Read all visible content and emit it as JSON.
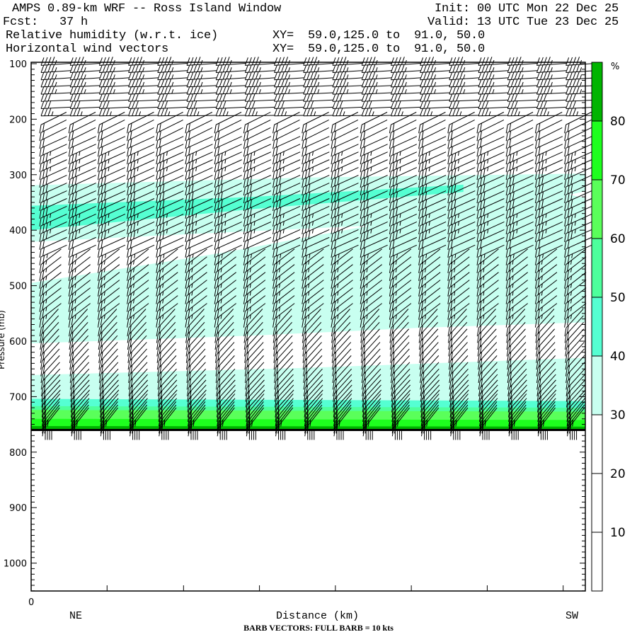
{
  "header": {
    "title": "AMPS 0.89-km WRF -- Ross Island Window",
    "init": "Init: 00 UTC Mon 22 Dec 25",
    "fcst": "Fcst:   37 h",
    "valid": "Valid: 13 UTC Tue 23 Dec 25",
    "field1": "Relative humidity (w.r.t. ice)",
    "field1_xy": "XY=  59.0,125.0 to  91.0, 50.0",
    "field2": "Horizontal wind vectors",
    "field2_xy": "XY=  59.0,125.0 to  91.0, 50.0"
  },
  "chart_data": {
    "type": "heatmap",
    "title": "Relative humidity (w.r.t. ice) and horizontal wind vectors cross-section",
    "xlabel": "Distance (km)",
    "x_start_label": "0",
    "x_left_label": "NE",
    "x_right_label": "SW",
    "ylabel": "Pressure (mb)",
    "ylim": [
      1050,
      100
    ],
    "y_ticks": [
      "100",
      "200",
      "300",
      "400",
      "500",
      "600",
      "700",
      "800",
      "900",
      "1000"
    ],
    "y_tick_values": [
      100,
      200,
      300,
      400,
      500,
      600,
      700,
      800,
      900,
      1000
    ],
    "x_range": [
      0,
      100
    ],
    "x_major_ticks": [
      0,
      13.7,
      27.5,
      41.2,
      54.9,
      68.6,
      82.3,
      96.0
    ],
    "surface_pressure": 760,
    "colorbar": {
      "unit": "%",
      "labels": [
        "80",
        "70",
        "60",
        "50",
        "40",
        "30",
        "20",
        "10"
      ],
      "bins": [
        {
          "min": 80,
          "max": 100,
          "color": "#00b400"
        },
        {
          "min": 70,
          "max": 80,
          "color": "#1eff1e"
        },
        {
          "min": 60,
          "max": 70,
          "color": "#5aff5a"
        },
        {
          "min": 50,
          "max": 60,
          "color": "#4dff9c"
        },
        {
          "min": 40,
          "max": 50,
          "color": "#55ffd2"
        },
        {
          "min": 30,
          "max": 40,
          "color": "#c8fff0"
        },
        {
          "min": 20,
          "max": 30,
          "color": "#ffffff"
        },
        {
          "min": 10,
          "max": 20,
          "color": "#ffffff"
        },
        {
          "min": 0,
          "max": 10,
          "color": "#ffffff"
        }
      ]
    },
    "rh_regions": [
      {
        "bin": "30-40",
        "color": "#c8fff0",
        "points": [
          [
            0,
            319
          ],
          [
            50,
            305
          ],
          [
            100,
            298
          ],
          [
            100,
            566
          ],
          [
            70,
            576
          ],
          [
            40,
            590
          ],
          [
            0,
            604
          ]
        ]
      },
      {
        "bin": "<30",
        "color": "#ffffff",
        "points": [
          [
            0,
            421
          ],
          [
            35,
            404
          ],
          [
            61,
            392
          ],
          [
            35,
            440
          ],
          [
            0,
            495
          ]
        ]
      },
      {
        "bin": "<30",
        "color": "#ffffff",
        "points": [
          [
            100,
            330
          ],
          [
            97,
            336
          ],
          [
            100,
            342
          ]
        ]
      },
      {
        "bin": "30-40",
        "color": "#c8fff0",
        "points": [
          [
            0,
            661
          ],
          [
            50,
            648
          ],
          [
            100,
            630
          ],
          [
            100,
            762
          ],
          [
            0,
            762
          ]
        ]
      },
      {
        "bin": "40-50",
        "color": "#55ffd2",
        "points": [
          [
            0,
            356
          ],
          [
            40,
            340
          ],
          [
            78,
            318
          ],
          [
            78,
            331
          ],
          [
            40,
            362
          ],
          [
            0,
            400
          ]
        ]
      },
      {
        "bin": "40-50",
        "color": "#55ffd2",
        "points": [
          [
            0,
            704
          ],
          [
            100,
            708
          ],
          [
            100,
            762
          ],
          [
            0,
            762
          ]
        ]
      },
      {
        "bin": "50-60",
        "color": "#4dff9c",
        "points": [
          [
            0,
            717
          ],
          [
            100,
            720
          ],
          [
            100,
            762
          ],
          [
            0,
            762
          ]
        ]
      },
      {
        "bin": "60-70",
        "color": "#5aff5a",
        "points": [
          [
            0,
            724
          ],
          [
            100,
            727
          ],
          [
            100,
            762
          ],
          [
            0,
            762
          ]
        ]
      },
      {
        "bin": "70-80",
        "color": "#1eff1e",
        "points": [
          [
            0,
            740
          ],
          [
            100,
            742
          ],
          [
            100,
            762
          ],
          [
            0,
            762
          ]
        ]
      },
      {
        "bin": ">80",
        "color": "#00b400",
        "points": [
          [
            0,
            753
          ],
          [
            100,
            754
          ],
          [
            100,
            762
          ],
          [
            0,
            762
          ]
        ]
      }
    ],
    "barbs": {
      "legend": "BARB VECTORS:  FULL BARB = 10 kts",
      "columns": 19,
      "levels": [
        [
          103,
          35,
          265
        ],
        [
          116,
          35,
          265
        ],
        [
          129,
          35,
          265
        ],
        [
          142,
          35,
          266
        ],
        [
          155,
          35,
          266
        ],
        [
          168,
          32,
          266
        ],
        [
          181,
          30,
          266
        ],
        [
          194,
          28,
          268
        ],
        [
          210,
          20,
          250
        ],
        [
          224,
          20,
          250
        ],
        [
          238,
          20,
          250
        ],
        [
          252,
          20,
          252
        ],
        [
          266,
          25,
          252
        ],
        [
          280,
          25,
          252
        ],
        [
          294,
          25,
          252
        ],
        [
          308,
          30,
          252
        ],
        [
          322,
          30,
          252
        ],
        [
          336,
          30,
          252
        ],
        [
          350,
          30,
          252
        ],
        [
          364,
          30,
          252
        ],
        [
          378,
          25,
          252
        ],
        [
          392,
          25,
          252
        ],
        [
          406,
          25,
          252
        ],
        [
          420,
          20,
          252
        ],
        [
          434,
          20,
          252
        ],
        [
          448,
          15,
          252
        ],
        [
          462,
          15,
          250
        ],
        [
          476,
          15,
          250
        ],
        [
          490,
          15,
          250
        ],
        [
          504,
          15,
          250
        ],
        [
          518,
          15,
          250
        ],
        [
          532,
          15,
          250
        ],
        [
          546,
          15,
          250
        ],
        [
          560,
          15,
          250
        ],
        [
          576,
          20,
          240
        ],
        [
          588,
          20,
          240
        ],
        [
          600,
          20,
          240
        ],
        [
          612,
          20,
          240
        ],
        [
          624,
          20,
          240
        ],
        [
          636,
          20,
          240
        ],
        [
          648,
          20,
          240
        ],
        [
          660,
          20,
          240
        ],
        [
          672,
          20,
          240
        ],
        [
          684,
          20,
          240
        ],
        [
          694,
          20,
          240
        ],
        [
          704,
          20,
          240
        ],
        [
          713,
          20,
          240
        ],
        [
          722,
          20,
          240
        ],
        [
          730,
          20,
          238
        ],
        [
          738,
          20,
          238
        ],
        [
          745,
          20,
          236
        ],
        [
          751,
          15,
          236
        ],
        [
          756,
          15,
          236
        ],
        [
          760,
          40,
          180
        ]
      ]
    }
  }
}
